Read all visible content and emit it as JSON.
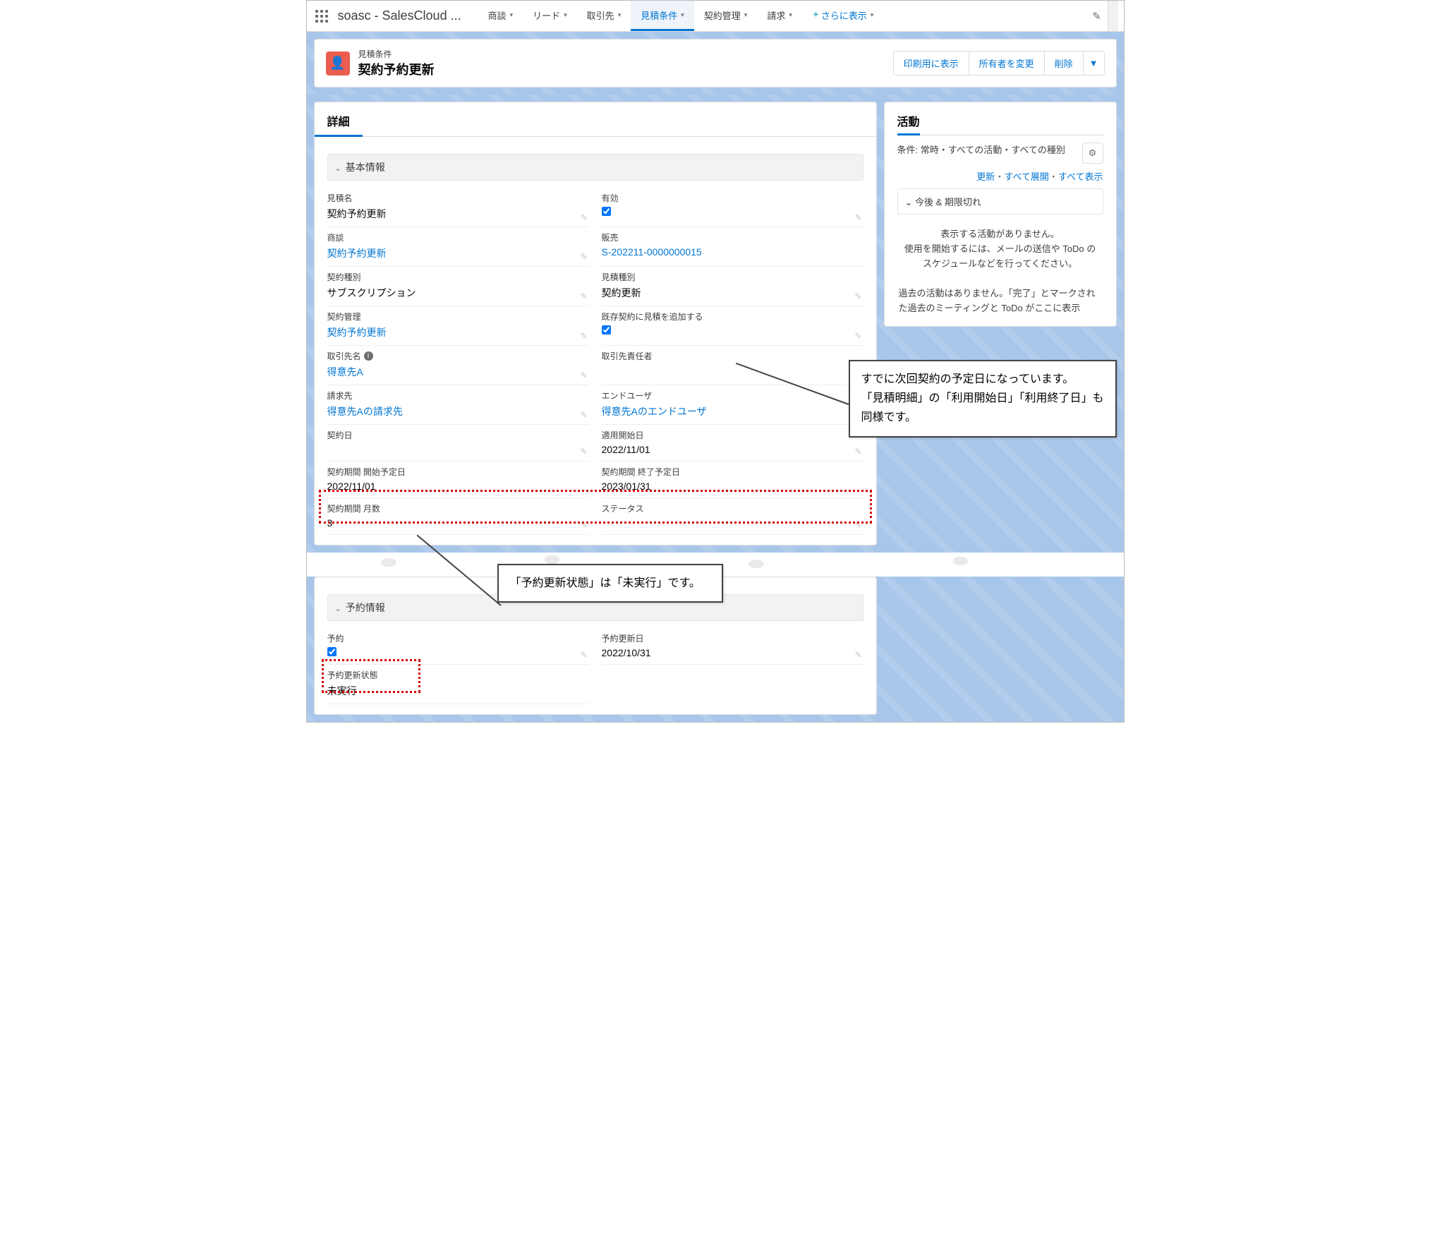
{
  "topnav": {
    "app_name": "soasc - SalesCloud ...",
    "tabs": [
      {
        "label": "商談"
      },
      {
        "label": "リード"
      },
      {
        "label": "取引先"
      },
      {
        "label": "見積条件",
        "active": true
      },
      {
        "label": "契約管理"
      },
      {
        "label": "請求"
      }
    ],
    "more": "さらに表示"
  },
  "header": {
    "object_label": "見積条件",
    "record_title": "契約予約更新",
    "actions": {
      "print": "印刷用に表示",
      "change_owner": "所有者を変更",
      "delete": "削除"
    }
  },
  "detail_tab": "詳細",
  "sections": {
    "basic": "基本情報",
    "reserve": "予約情報"
  },
  "fields": {
    "quote_name": {
      "label": "見積名",
      "value": "契約予約更新"
    },
    "enabled": {
      "label": "有効",
      "checked": true
    },
    "opportunity": {
      "label": "商談",
      "value": "契約予約更新",
      "link": true
    },
    "sale": {
      "label": "販売",
      "value": "S-202211-0000000015",
      "link": true
    },
    "contract_kind": {
      "label": "契約種別",
      "value": "サブスクリプション"
    },
    "quote_kind": {
      "label": "見積種別",
      "value": "契約更新"
    },
    "contract_mgmt": {
      "label": "契約管理",
      "value": "契約予約更新",
      "link": true
    },
    "add_existing": {
      "label": "既存契約に見積を追加する",
      "checked": true
    },
    "account": {
      "label": "取引先名",
      "value": "得意先A",
      "link": true,
      "info": true
    },
    "responsible": {
      "label": "取引先責任者",
      "value": ""
    },
    "billing": {
      "label": "請求先",
      "value": "得意先Aの請求先",
      "link": true
    },
    "end_user": {
      "label": "エンドユーザ",
      "value": "得意先Aのエンドユーザ",
      "link": true
    },
    "contract_date": {
      "label": "契約日",
      "value": ""
    },
    "apply_start": {
      "label": "適用開始日",
      "value": "2022/11/01"
    },
    "period_start": {
      "label": "契約期間 開始予定日",
      "value": "2022/11/01"
    },
    "period_end": {
      "label": "契約期間 終了予定日",
      "value": "2023/01/31"
    },
    "period_months": {
      "label": "契約期間 月数",
      "value": "3"
    },
    "status": {
      "label": "ステータス",
      "value": ""
    },
    "reserved": {
      "label": "予約",
      "checked": true
    },
    "reserve_date": {
      "label": "予約更新日",
      "value": "2022/10/31"
    },
    "reserve_state": {
      "label": "予約更新状態",
      "value": "未実行"
    }
  },
  "activity": {
    "title": "活動",
    "filters": "条件: 常時・すべての活動・すべての種別",
    "links": {
      "refresh": "更新",
      "expand": "すべて展開",
      "show": "すべて表示"
    },
    "sep": "・",
    "section": "今後 & 期限切れ",
    "empty1": "表示する活動がありません。",
    "empty2": "使用を開始するには、メールの送信や ToDo のスケジュールなどを行ってください。",
    "past": "過去の活動はありません。「完了」とマークされた過去のミーティングと ToDo がここに表示"
  },
  "annotations": {
    "a1": {
      "l1": "すでに次回契約の予定日になっています。",
      "l2": "「見積明細」の「利用開始日」「利用終了日」も",
      "l3": "同様です。"
    },
    "a2": "「予約更新状態」は「未実行」です。"
  }
}
